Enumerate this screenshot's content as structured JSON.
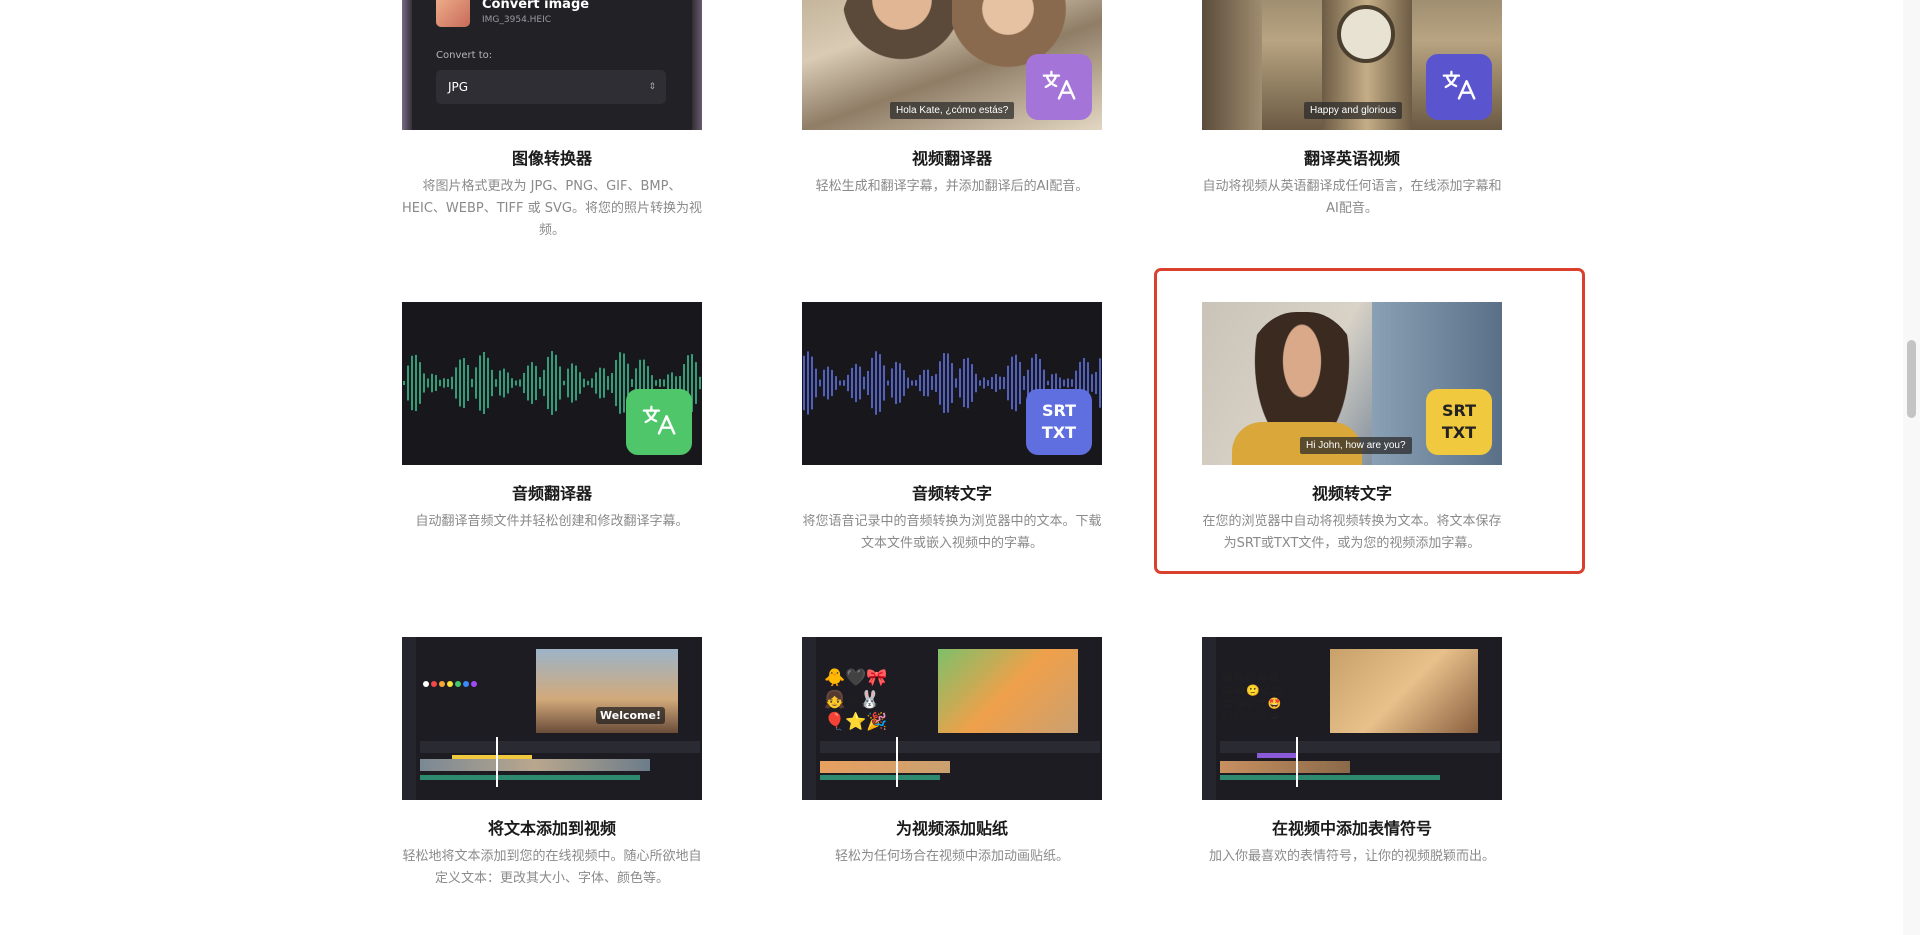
{
  "cards": [
    {
      "title": "图像转换器",
      "desc": "将图片格式更改为 JPG、PNG、GIF、BMP、HEIC、WEBP、TIFF 或 SVG。将您的照片转换为视频。",
      "mock": {
        "heading": "Convert image",
        "filename": "IMG_3954.HEIC",
        "convert_label": "Convert to:",
        "format": "JPG"
      }
    },
    {
      "title": "视频翻译器",
      "desc": "轻松生成和翻译字幕，并添加翻译后的AI配音。",
      "caption": "Hola Kate, ¿cómo estás?",
      "badge_color": "#a474d8"
    },
    {
      "title": "翻译英语视频",
      "desc": "自动将视频从英语翻译成任何语言，在线添加字幕和AI配音。",
      "caption": "Happy and glorious",
      "badge_color": "#5b54cf"
    },
    {
      "title": "音频翻译器",
      "desc": "自动翻译音频文件并轻松创建和修改翻译字幕。",
      "badge_color": "#4fc66a",
      "wave_color": "#3bbf8e"
    },
    {
      "title": "音频转文字",
      "desc": "将您语音记录中的音频转换为浏览器中的文本。下载文本文件或嵌入视频中的字幕。",
      "badge_line1": "SRT",
      "badge_line2": "TXT",
      "badge_color": "#5f6fe0",
      "wave_color": "#6272e6"
    },
    {
      "title": "视频转文字",
      "desc": "在您的浏览器中自动将视频转换为文本。将文本保存为SRT或TXT文件，或为您的视频添加字幕。",
      "caption": "Hi John, how are you?",
      "badge_line1": "SRT",
      "badge_line2": "TXT",
      "badge_color": "#f1c93f"
    },
    {
      "title": "将文本添加到视频",
      "desc": "轻松地将文本添加到您的在线视频中。随心所欲地自定义文本：更改其大小、字体、颜色等。",
      "overlay": "Welcome!"
    },
    {
      "title": "为视频添加贴纸",
      "desc": "轻松为任何场合在视频中添加动画贴纸。"
    },
    {
      "title": "在视频中添加表情符号",
      "desc": "加入你最喜欢的表情符号，让你的视频脱颖而出。"
    }
  ]
}
